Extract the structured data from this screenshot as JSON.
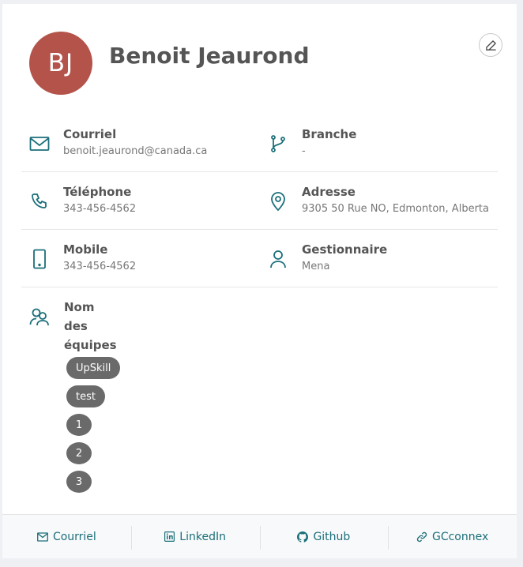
{
  "profile": {
    "initials": "BJ",
    "name": "Benoit Jeaurond",
    "avatar_color": "#b3534a"
  },
  "fields": {
    "email": {
      "label": "Courriel",
      "value": "benoit.jeaurond@canada.ca",
      "icon": "mail-icon"
    },
    "branch": {
      "label": "Branche",
      "value": "-",
      "icon": "git-branch-icon"
    },
    "phone": {
      "label": "Téléphone",
      "value": "343-456-4562",
      "icon": "phone-icon"
    },
    "address": {
      "label": "Adresse",
      "value": "9305 50 Rue NO, Edmonton, Alberta",
      "icon": "location-pin-icon"
    },
    "mobile": {
      "label": "Mobile",
      "value": "343-456-4562",
      "icon": "mobile-phone-icon"
    },
    "manager": {
      "label": "Gestionnaire",
      "value": "Mena",
      "icon": "person-icon"
    }
  },
  "teams": {
    "label": "Nom des équipes",
    "icon": "team-icon",
    "items": [
      "UpSkill",
      "test",
      "1",
      "2",
      "3"
    ]
  },
  "footer": {
    "email": "Courriel",
    "linkedin": "LinkedIn",
    "github": "Github",
    "gcconnex": "GCconnex"
  },
  "colors": {
    "accent": "#1b6f7a",
    "chip": "#6a6a6a"
  }
}
